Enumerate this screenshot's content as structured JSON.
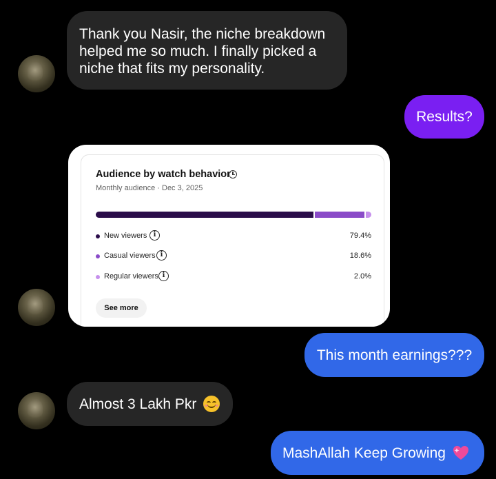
{
  "messages": {
    "incoming_1": [
      "Thank you Nasir, the niche breakdown",
      "helped me so much. I finally picked a",
      "niche that fits my personality."
    ],
    "outgoing_results": "Results?",
    "outgoing_earnings": "This month earnings???",
    "incoming_lakh": "Almost 3 Lakh Pkr",
    "outgoing_growing": "MashAllah Keep Growing"
  },
  "card": {
    "title": "Audience by watch behavior",
    "subtitle": "Monthly audience · Dec 3, 2025",
    "segments": [
      {
        "label": "New viewers",
        "value": "79.4%",
        "fraction": 0.794,
        "color": "#2b0d4a"
      },
      {
        "label": "Casual viewers",
        "value": "18.6%",
        "fraction": 0.186,
        "color": "#8a4bc8"
      },
      {
        "label": "Regular viewers",
        "value": "2.0%",
        "fraction": 0.02,
        "color": "#c690ec"
      }
    ],
    "see_more": "See more"
  },
  "icons": {
    "avatar": "profile-photo",
    "clock": "clock-icon",
    "info": "info-icon",
    "smile": "smiling-face-emoji",
    "heart": "sparkling-heart-emoji"
  },
  "colors": {
    "incoming_bubble": "#262626",
    "results_bubble": "#7a1ff2",
    "outgoing_bubble": "#3168e8"
  }
}
